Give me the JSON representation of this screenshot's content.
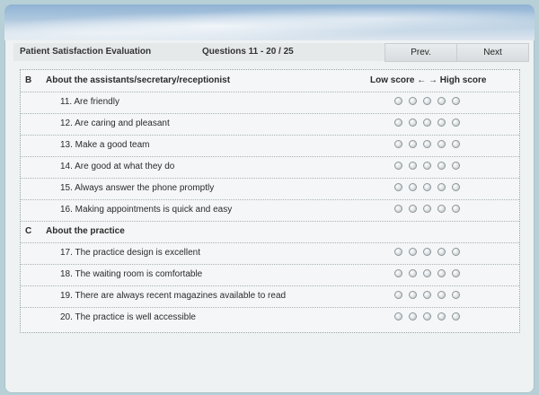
{
  "header": {
    "title": "Patient Satisfaction Evaluation",
    "progress": "Questions 11 - 20 / 25",
    "prev_label": "Prev.",
    "next_label": "Next"
  },
  "section_b": {
    "letter": "B",
    "title": "About the assistants/secretary/receptionist",
    "scale_label": "Low score ← → High score",
    "questions": [
      "11. Are friendly",
      "12. Are caring and pleasant",
      "13. Make a good team",
      "14. Are good at what they do",
      "15. Always answer the phone promptly",
      "16. Making appointments is quick and easy"
    ]
  },
  "section_c": {
    "letter": "C",
    "title": "About the practice",
    "questions": [
      "17. The practice design is excellent",
      "18. The waiting room is comfortable",
      "19. There are always recent magazines available to read",
      "20. The practice is well accessible"
    ]
  }
}
